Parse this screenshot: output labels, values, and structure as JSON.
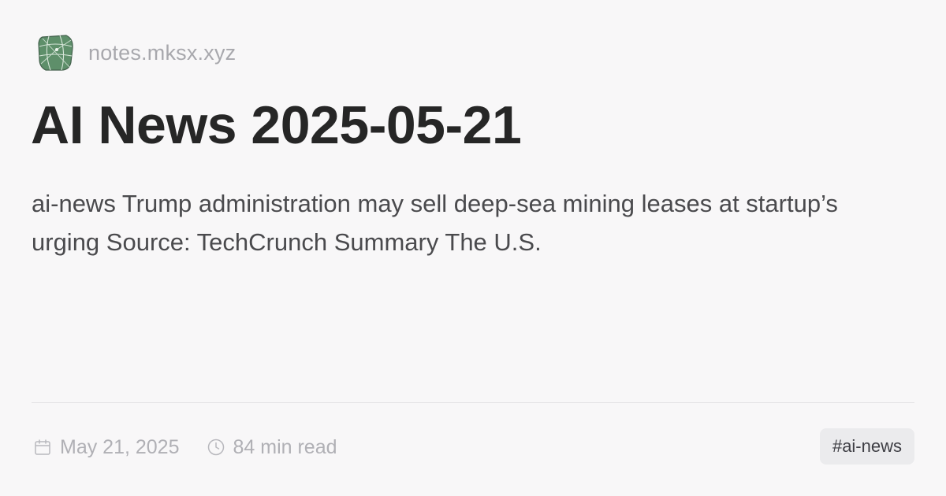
{
  "site": {
    "name": "notes.mksx.xyz",
    "logo_icon": "globe-map-icon",
    "logo_color": "#5e8f6a"
  },
  "post": {
    "title": "AI News 2025-05-21",
    "summary": "ai-news Trump administration may sell deep-sea mining leases at startup’s urging Source: TechCrunch Summary The U.S."
  },
  "meta": {
    "date": "May 21, 2025",
    "date_icon": "calendar-icon",
    "read_time": "84 min read",
    "read_time_icon": "clock-icon"
  },
  "tags": [
    "#ai-news"
  ],
  "colors": {
    "background": "#f8f7f8",
    "title": "#262626",
    "muted": "#b0b0b5",
    "tag_background": "#ebebed"
  }
}
